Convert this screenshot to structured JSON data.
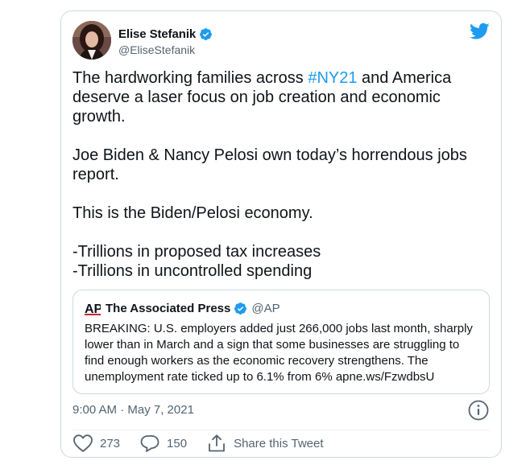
{
  "author": {
    "name": "Elise Stefanik",
    "handle": "@EliseStefanik"
  },
  "tweet": {
    "line1_pre": "The hardworking families across ",
    "hashtag": "#NY21",
    "line1_post": " and America deserve a laser focus on job creation and economic growth.",
    "paragraph2": "Joe Biden & Nancy Pelosi own today’s horrendous jobs report.",
    "paragraph3": "This is the Biden/Pelosi economy.",
    "bullet1": "-Trillions in proposed tax increases",
    "bullet2": "-Trillions in uncontrolled spending"
  },
  "quote": {
    "logo_text": "AP",
    "name": "The Associated Press",
    "handle": "@AP",
    "body": "BREAKING: U.S. employers added just 266,000 jobs last month, sharply lower than in March and a sign that some businesses are struggling to find enough workers as the economic recovery strengthens. The unemployment rate ticked up to 6.1% from 6% apne.ws/FzwdbsU"
  },
  "timestamp": "9:00 AM · May 7, 2021",
  "actions": {
    "likes": "273",
    "replies": "150",
    "share_label": "Share this Tweet"
  },
  "icons": {
    "bird": "twitter-bird-icon",
    "verified": "verified-badge-icon",
    "info": "info-icon",
    "like": "heart-icon",
    "reply": "reply-bubble-icon",
    "share": "share-icon"
  },
  "colors": {
    "accent": "#1d9bf0",
    "text": "#0f1419",
    "secondary": "#536471",
    "border": "#cfd9de",
    "ap_red": "#d41e36"
  }
}
